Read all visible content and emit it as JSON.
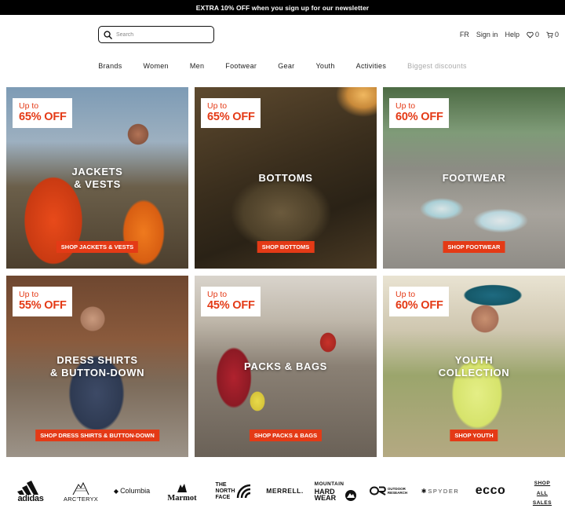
{
  "promo": {
    "text": "EXTRA 10% OFF when you sign up for our newsletter"
  },
  "search": {
    "placeholder": "Search"
  },
  "utility": {
    "lang": "FR",
    "signin": "Sign in",
    "help": "Help",
    "wishlist_count": "0",
    "cart_count": "0"
  },
  "nav": {
    "items": [
      "Brands",
      "Women",
      "Men",
      "Footwear",
      "Gear",
      "Youth",
      "Activities",
      "Biggest discounts"
    ]
  },
  "tiles": [
    {
      "upto": "Up to",
      "pct": "65% OFF",
      "title_1": "JACKETS",
      "title_2": "& VESTS",
      "cta": "SHOP JACKETS & VESTS"
    },
    {
      "upto": "Up to",
      "pct": "65% OFF",
      "title_1": "BOTTOMS",
      "cta": "SHOP BOTTOMS"
    },
    {
      "upto": "Up to",
      "pct": "60% OFF",
      "title_1": "FOOTWEAR",
      "cta": "SHOP FOOTWEAR"
    },
    {
      "upto": "Up to",
      "pct": "55% OFF",
      "title_1": "DRESS SHIRTS",
      "title_2": "& BUTTON-DOWN",
      "cta": "SHOP DRESS SHIRTS & BUTTON-DOWN"
    },
    {
      "upto": "Up to",
      "pct": "45% OFF",
      "title_1": "PACKS & BAGS",
      "cta": "SHOP PACKS & BAGS"
    },
    {
      "upto": "Up to",
      "pct": "60% OFF",
      "title_1": "YOUTH",
      "title_2": "COLLECTION",
      "cta": "SHOP YOUTH"
    }
  ],
  "brands": {
    "adidas": "adidas",
    "arcteryx": "ARC'TERYX",
    "columbia": "Columbia",
    "marmot": "Marmot",
    "tnf_1": "THE",
    "tnf_2": "NORTH",
    "tnf_3": "FACE",
    "merrell": "MERRELL.",
    "mhw_1": "MOUNTAIN",
    "mhw_2": "HARD",
    "mhw_3": "WEAR",
    "or_1": "OUTDOOR",
    "or_2": "RESEARCH",
    "spyder": "SPYDER",
    "ecco": "ecco",
    "shop_all_1": "SHOP",
    "shop_all_2": "ALL",
    "shop_all_3": "SALES"
  },
  "colors": {
    "accent": "#e43a16",
    "promo_bg": "#000000"
  },
  "icons": [
    "search-icon",
    "heart-icon",
    "cart-icon"
  ]
}
